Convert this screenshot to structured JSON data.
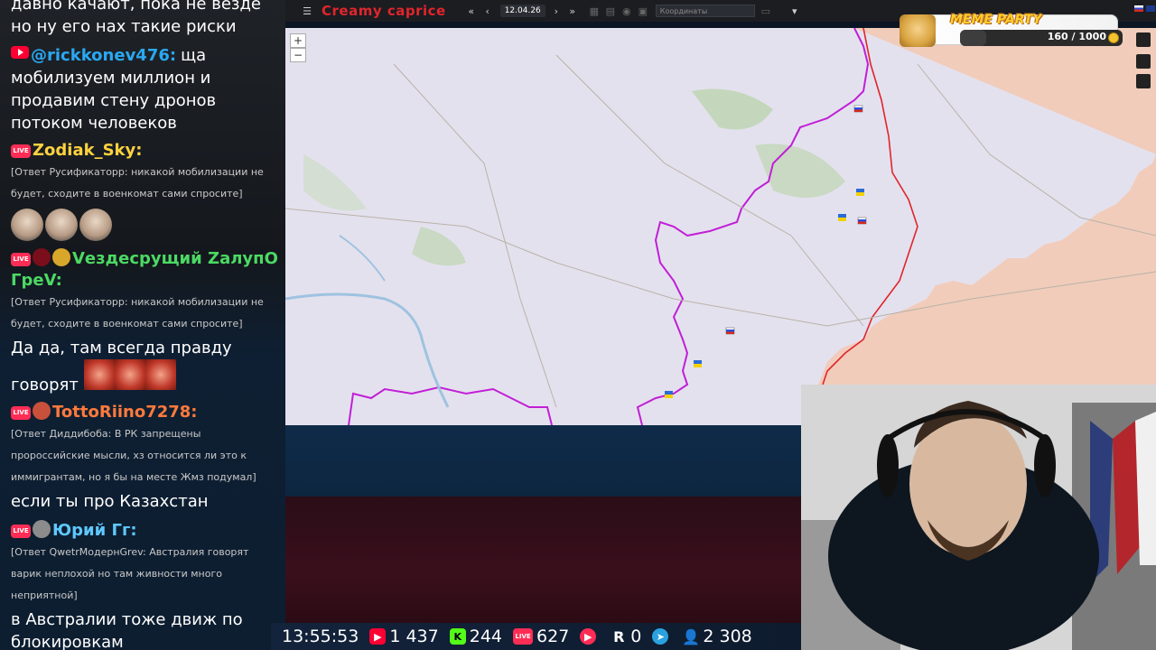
{
  "chat": {
    "messages": [
      {
        "kind": "text",
        "text": "давно качают, пока не везде"
      },
      {
        "kind": "text",
        "text": "но ну его нах такие риски"
      },
      {
        "kind": "author",
        "platform": "youtube",
        "name": "@rickkonev476:",
        "color": "#2aa8f2",
        "text": "ща мобилизуем миллион и продавим стену дронов потоком человеков"
      },
      {
        "kind": "author",
        "platform": "live",
        "name": "Zodiak_Sky:",
        "color": "#ffd23f"
      },
      {
        "kind": "reply",
        "text": "[Ответ Русификаторр: никакой мобилизации не будет, сходите в военкомат сами спросите]"
      },
      {
        "kind": "author",
        "platform": "live",
        "name": "Vездесрущий ZалупО ГреV:",
        "color": "#4cd964"
      },
      {
        "kind": "reply",
        "text": "[Ответ Русификаторр: никакой мобилизации не будет, сходите в военкомат сами спросите]"
      },
      {
        "kind": "text",
        "text": "Да да, там всегда правду говорят"
      },
      {
        "kind": "author",
        "platform": "live",
        "name": "TottoRiino7278:",
        "color": "#ff7a3c"
      },
      {
        "kind": "reply",
        "text": "[Ответ Диддибоба: В РК запрещены пророссийские мысли, хз относится ли это к иммигрантам, но я бы на месте Жмз подумал]"
      },
      {
        "kind": "text",
        "text": "если ты про Казахстан"
      },
      {
        "kind": "author",
        "platform": "live",
        "name": "Юрий Гг:",
        "color": "#5ec8ff"
      },
      {
        "kind": "reply",
        "text": "[Ответ QwetrМодернGrev: Австралия говорят варик неплохой но там живности много неприятной]"
      },
      {
        "kind": "text",
        "text": "в Австралии тоже движ по блокировкам"
      }
    ]
  },
  "map": {
    "title": "Creamy caprice",
    "date": "12.04.26",
    "coords_placeholder": "Координаты",
    "zoom_in": "+",
    "zoom_out": "−"
  },
  "meme_party": {
    "title": "MEME PARTY",
    "count": "160 / 1000",
    "progress": 0.16
  },
  "stats": {
    "time": "13:55:53",
    "youtube": "1 437",
    "kick": "244",
    "live": "627",
    "rutube": "",
    "r": "0",
    "telegram": "",
    "total": "2 308"
  },
  "colors": {
    "frontline": "#c11fd6",
    "occupied": "#f6c9b3",
    "ukraine": "#e1def0",
    "accent_red": "#e0252c"
  }
}
